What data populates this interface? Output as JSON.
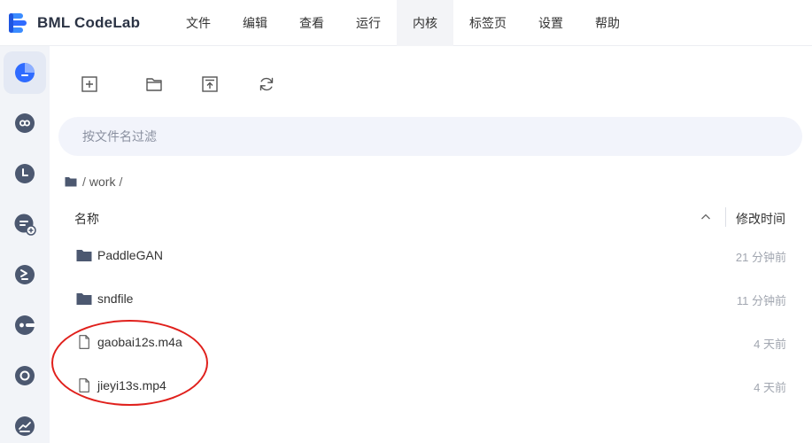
{
  "brand": {
    "name": "BML CodeLab"
  },
  "menu": [
    {
      "label": "文件"
    },
    {
      "label": "编辑"
    },
    {
      "label": "查看"
    },
    {
      "label": "运行"
    },
    {
      "label": "内核",
      "active": true
    },
    {
      "label": "标签页"
    },
    {
      "label": "设置"
    },
    {
      "label": "帮助"
    }
  ],
  "sidebar": {
    "items": [
      {
        "icon": "file-browser-icon",
        "active": true
      },
      {
        "icon": "link-icon"
      },
      {
        "icon": "clock-icon"
      },
      {
        "icon": "list-add-icon"
      },
      {
        "icon": "terminal-icon"
      },
      {
        "icon": "toggle-icon"
      },
      {
        "icon": "circle-icon"
      },
      {
        "icon": "chart-icon"
      }
    ]
  },
  "toolbar": {
    "items": [
      {
        "icon": "new-file-icon"
      },
      {
        "icon": "new-folder-icon"
      },
      {
        "icon": "upload-icon"
      },
      {
        "icon": "refresh-icon"
      }
    ]
  },
  "filter": {
    "placeholder": "按文件名过滤",
    "value": ""
  },
  "breadcrumb": {
    "root": "/",
    "folder": "work",
    "trail": "/"
  },
  "list": {
    "header": {
      "name": "名称",
      "modified": "修改时间"
    },
    "rows": [
      {
        "type": "folder",
        "name": "PaddleGAN",
        "modified": "21 分钟前"
      },
      {
        "type": "folder",
        "name": "sndfile",
        "modified": "11 分钟前"
      },
      {
        "type": "file",
        "name": "gaobai12s.m4a",
        "modified": "4 天前"
      },
      {
        "type": "file",
        "name": "jieyi13s.mp4",
        "modified": "4 天前"
      }
    ]
  },
  "colors": {
    "accent": "#2f6bff",
    "icon_dark": "#4c5870",
    "annotation": "#e0201c"
  }
}
